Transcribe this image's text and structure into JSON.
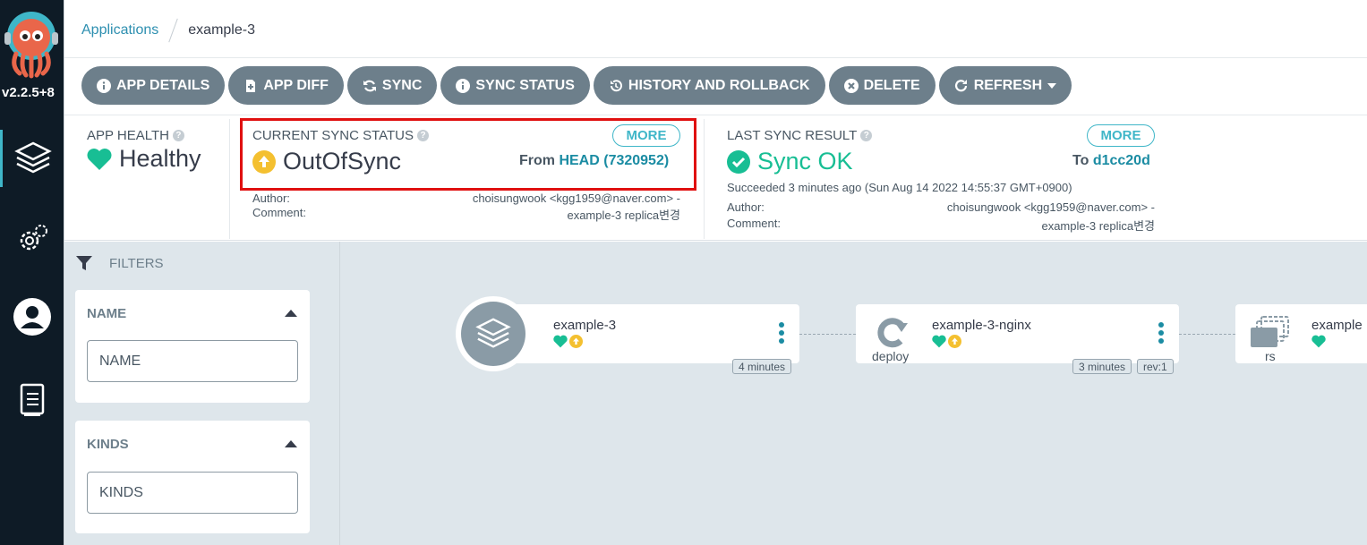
{
  "sidebar": {
    "version": "v2.2.5+8",
    "nav": [
      "applications-icon",
      "settings-icon",
      "user-icon",
      "docs-icon"
    ]
  },
  "breadcrumb": {
    "parent": "Applications",
    "current": "example-3"
  },
  "toolbar": {
    "app_details": "APP DETAILS",
    "app_diff": "APP DIFF",
    "sync": "SYNC",
    "sync_status": "SYNC STATUS",
    "history": "HISTORY AND ROLLBACK",
    "delete": "DELETE",
    "refresh": "REFRESH"
  },
  "app_health": {
    "title": "APP HEALTH",
    "value": "Healthy"
  },
  "current_sync": {
    "title": "CURRENT SYNC STATUS",
    "more": "MORE",
    "value": "OutOfSync",
    "from_label": "From",
    "revision": "HEAD (7320952)",
    "author_label": "Author:",
    "comment_label": "Comment:",
    "author": "choisungwook <kgg1959@naver.com> -",
    "comment": "example-3 replica변경"
  },
  "last_sync": {
    "title": "LAST SYNC RESULT",
    "more": "MORE",
    "value": "Sync OK",
    "to_label": "To",
    "revision": "d1cc20d",
    "succeeded": "Succeeded 3 minutes ago (Sun Aug 14 2022 14:55:37 GMT+0900)",
    "author_label": "Author:",
    "comment_label": "Comment:",
    "author": "choisungwook <kgg1959@naver.com> -",
    "comment": "example-3 replica변경"
  },
  "filters": {
    "title": "FILTERS",
    "name_title": "NAME",
    "name_placeholder": "NAME",
    "kinds_title": "KINDS",
    "kinds_placeholder": "KINDS"
  },
  "nodes": {
    "app": {
      "name": "example-3",
      "age": "4 minutes"
    },
    "deploy": {
      "name": "example-3-nginx",
      "kind": "deploy",
      "age": "3 minutes",
      "rev": "rev:1"
    },
    "rs": {
      "name": "example",
      "kind": "rs"
    }
  },
  "colors": {
    "sidebar": "#0e1b26",
    "accent": "#3fb6c8",
    "healthy": "#18be94",
    "outofsync": "#f4c030",
    "button": "#6d7f8b",
    "highlight": "#e01010"
  }
}
